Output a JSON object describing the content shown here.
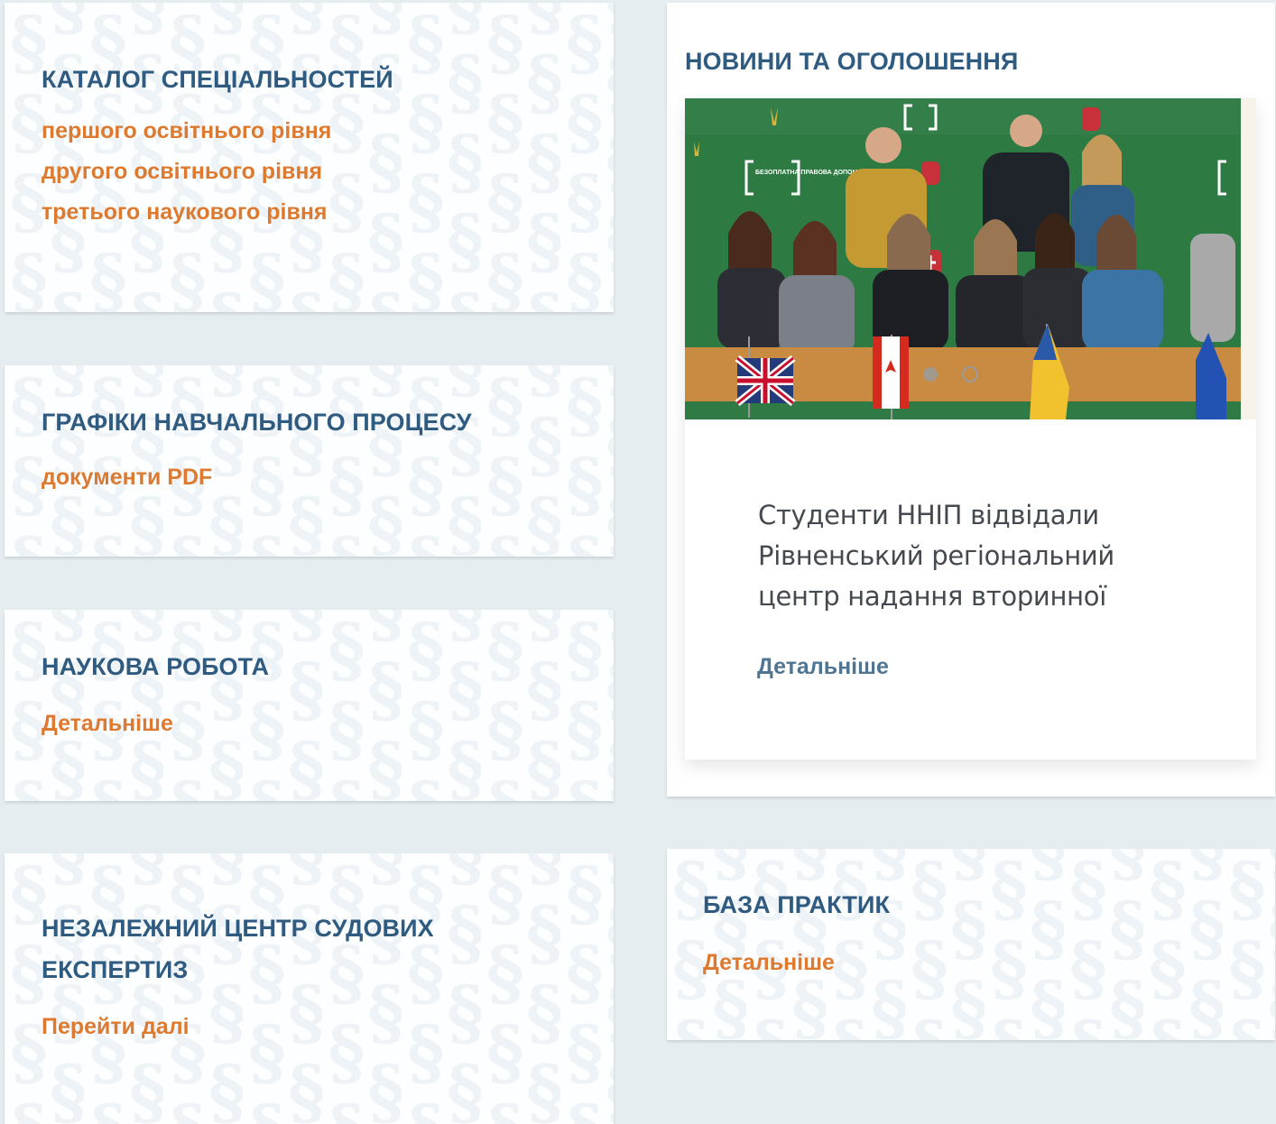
{
  "catalog": {
    "title": "КАТАЛОГ СПЕЦІАЛЬНОСТЕЙ",
    "links": [
      "першого освітнього рівня",
      "другого освітнього рівня",
      "третього наукового рівня"
    ]
  },
  "schedules": {
    "title": "ГРАФІКИ НАВЧАЛЬНОГО ПРОЦЕСУ",
    "link": "документи PDF"
  },
  "research": {
    "title": "НАУКОВА РОБОТА",
    "link": "Детальніше"
  },
  "expertise": {
    "title": "НЕЗАЛЕЖНИЙ ЦЕНТР СУДОВИХ ЕКСПЕРТИЗ",
    "link": "Перейти далі"
  },
  "practice": {
    "title": "БАЗА ПРАКТИК",
    "link": "Детальніше"
  },
  "news": {
    "title": "НОВИНИ ТА ОГОЛОШЕННЯ",
    "item": {
      "headline": "Студенти ННІП відвідали Рівненський регіональний центр надання вторинної",
      "more": "Детальніше",
      "photo_banner": "БЕЗОПЛАТНА ПРАВОВА ДОПОМОГА"
    }
  },
  "colors": {
    "title": "#2f5b80",
    "link": "#dd7a2f",
    "news_link": "#4f7593",
    "background": "#e6edf0"
  }
}
